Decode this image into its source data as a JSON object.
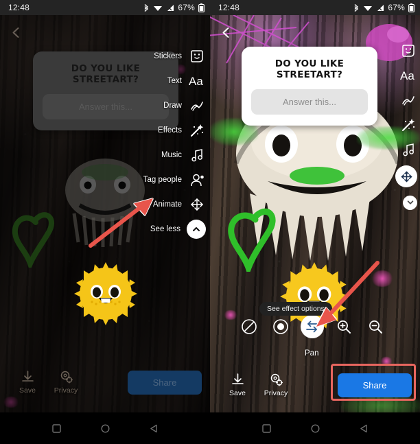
{
  "status_bar": {
    "time": "12:48",
    "battery_percent": "67%",
    "icons": [
      "bluetooth-icon",
      "wifi-icon",
      "cellular-signal-icon",
      "battery-icon"
    ]
  },
  "panels": [
    {
      "id": "left",
      "state": "sticker-editing-dimmed",
      "back_button": "back-arrow-icon",
      "question_sticker": {
        "title": "DO YOU LIKE STREETART?",
        "answer_placeholder": "Answer this..."
      },
      "tool_rail": [
        {
          "label": "Stickers",
          "icon": "sticker-face-icon"
        },
        {
          "label": "Text",
          "icon": "text-aa-icon"
        },
        {
          "label": "Draw",
          "icon": "draw-squiggle-icon"
        },
        {
          "label": "Effects",
          "icon": "effects-wand-icon"
        },
        {
          "label": "Music",
          "icon": "music-note-icon"
        },
        {
          "label": "Tag people",
          "icon": "tag-person-icon"
        },
        {
          "label": "Animate",
          "icon": "animate-move-icon"
        },
        {
          "label": "See less",
          "icon": "chevron-up-icon"
        }
      ],
      "bottom_bar": {
        "actions": [
          {
            "label": "Save",
            "icon": "download-icon"
          },
          {
            "label": "Privacy",
            "icon": "privacy-gear-icon"
          }
        ],
        "share_label": "Share"
      },
      "annotation": {
        "type": "red-arrow",
        "points_to": "Animate"
      }
    },
    {
      "id": "right",
      "state": "animate-pan-effect",
      "back_button": "back-arrow-icon",
      "question_sticker": {
        "title": "DO YOU LIKE STREETART?",
        "answer_placeholder": "Answer this..."
      },
      "tool_rail": [
        {
          "label": "",
          "icon": "sticker-face-icon"
        },
        {
          "label": "",
          "icon": "text-aa-icon"
        },
        {
          "label": "",
          "icon": "draw-squiggle-icon"
        },
        {
          "label": "",
          "icon": "effects-wand-icon"
        },
        {
          "label": "",
          "icon": "music-note-icon"
        },
        {
          "label": "",
          "icon": "animate-move-icon"
        },
        {
          "label": "",
          "icon": "chevron-down-icon"
        }
      ],
      "effects_toolbar": {
        "tooltip": "See effect options",
        "selected_caption": "Pan",
        "buttons": [
          {
            "name": "no-effect-button",
            "icon": "slash-circle-icon",
            "selected": false
          },
          {
            "name": "focus-button",
            "icon": "filled-dot-icon",
            "selected": false
          },
          {
            "name": "pan-button",
            "icon": "pan-arrows-icon",
            "selected": true
          },
          {
            "name": "zoom-in-button",
            "icon": "magnifier-plus-icon",
            "selected": false
          },
          {
            "name": "zoom-out-button",
            "icon": "magnifier-minus-icon",
            "selected": false
          }
        ]
      },
      "bottom_bar": {
        "actions": [
          {
            "label": "Save",
            "icon": "download-icon"
          },
          {
            "label": "Privacy",
            "icon": "privacy-gear-icon"
          }
        ],
        "share_label": "Share",
        "share_highlighted": true
      },
      "annotation": {
        "type": "red-arrow",
        "points_to": "Pan"
      }
    }
  ],
  "nav_bar": {
    "buttons": [
      {
        "name": "recents-button",
        "icon": "square-icon"
      },
      {
        "name": "home-button",
        "icon": "circle-icon"
      },
      {
        "name": "back-button",
        "icon": "triangle-left-icon"
      }
    ]
  },
  "colors": {
    "share_blue": "#1a78e5",
    "highlight_red": "#e8665f",
    "arrow_red": "#e8554b",
    "sun_yellow": "#f5c518"
  }
}
